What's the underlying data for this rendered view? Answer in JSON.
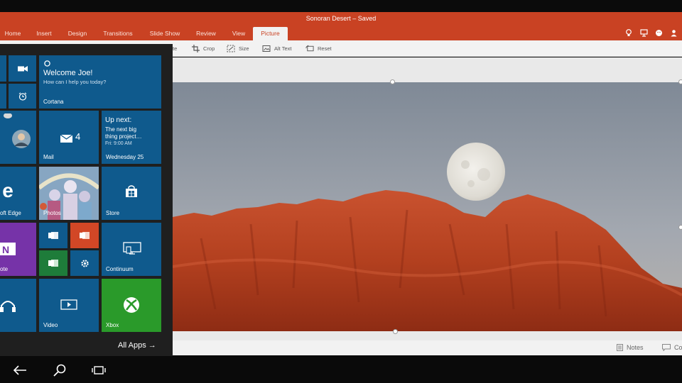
{
  "window": {
    "title": "Sonoran Desert – Saved"
  },
  "ribbon": {
    "tabs": [
      {
        "label": "Home"
      },
      {
        "label": "Insert"
      },
      {
        "label": "Design"
      },
      {
        "label": "Transitions"
      },
      {
        "label": "Slide Show"
      },
      {
        "label": "Review"
      },
      {
        "label": "View"
      },
      {
        "label": "Picture",
        "active": true
      }
    ],
    "right_icons": [
      "lightbulb-icon",
      "present-icon",
      "emoji-icon",
      "share-icon"
    ]
  },
  "toolbar": {
    "partial_label": "te",
    "crop_label": "Crop",
    "size_label": "Size",
    "alt_text_label": "Alt Text",
    "reset_label": "Reset"
  },
  "status": {
    "notes_label": "Notes",
    "comments_partial": "Co"
  },
  "start_menu": {
    "cortana": {
      "greeting": "Welcome Joe!",
      "prompt": "How can I help you today?",
      "label": "Cortana"
    },
    "mail": {
      "label": "Mail",
      "count": "4"
    },
    "calendar": {
      "heading": "Up next:",
      "event_line1": "The next big",
      "event_line2": "thing project…",
      "time": "Fri: 9:00 AM",
      "day": "Wednesday 25"
    },
    "edge_label": "oft Edge",
    "photos_label": "Photos",
    "store_label": "Store",
    "onenote_label": "ote",
    "continuum_label": "Continuum",
    "video_label": "Video",
    "xbox_label": "Xbox",
    "all_apps": "All Apps →"
  },
  "colors": {
    "accent": "#c94223",
    "tile_blue": "#0f5a8d",
    "onenote_purple": "#7633a8",
    "excel_green": "#1e7c3a",
    "office_red": "#d24726",
    "xbox_green": "#2a9a2a"
  }
}
